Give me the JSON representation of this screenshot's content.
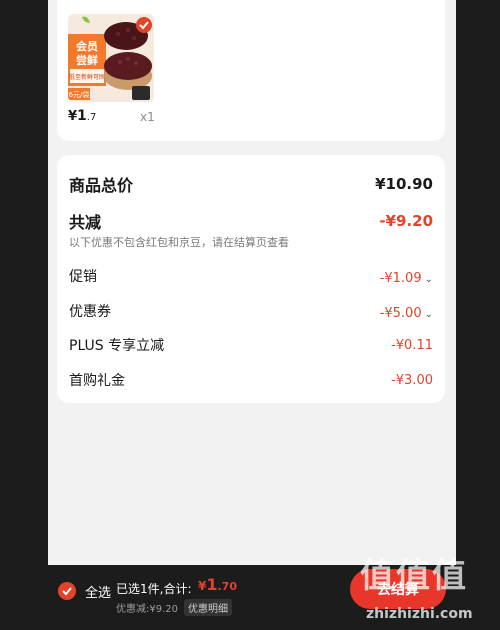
{
  "product": {
    "image_name": "red-bean-product-image",
    "image_badge_text": "会员尝鲜",
    "image_promo_text": "低至新鲜可囤可做",
    "image_price_tag": "6元/袋",
    "price_currency": "¥",
    "price_integer": "1",
    "price_decimal": ".7",
    "quantity": "x1",
    "checked_icon": "check-circle-icon"
  },
  "summary": {
    "total_label": "商品总价",
    "total_value": "¥10.90",
    "reduction_label": "共减",
    "reduction_value": "-¥9.20",
    "note": "以下优惠不包含红包和京豆，请在结算页查看",
    "rows": [
      {
        "label": "促销",
        "value": "-¥1.09",
        "expand_icon": "chevron-down-icon"
      },
      {
        "label": "优惠券",
        "value": "-¥5.00",
        "expand_icon": "chevron-down-icon"
      },
      {
        "label": "PLUS 专享立减",
        "value": "-¥0.11"
      },
      {
        "label": "首购礼金",
        "value": "-¥3.00"
      }
    ]
  },
  "bottom_bar": {
    "select_all_label": "全选",
    "selected_text": "已选1件,合计:",
    "total_currency": "¥",
    "total_integer": "1",
    "total_decimal": ".70",
    "discount_text": "优惠减:¥9.20",
    "discount_detail_label": "优惠明细",
    "checkout_label": "去结算"
  },
  "watermark": {
    "logo_text": "值值值",
    "url": "zhizhizhi.com"
  },
  "colors": {
    "accent": "#e2432b",
    "background": "#f2f2f2",
    "card": "#ffffff",
    "dark": "#1c1c1c"
  }
}
